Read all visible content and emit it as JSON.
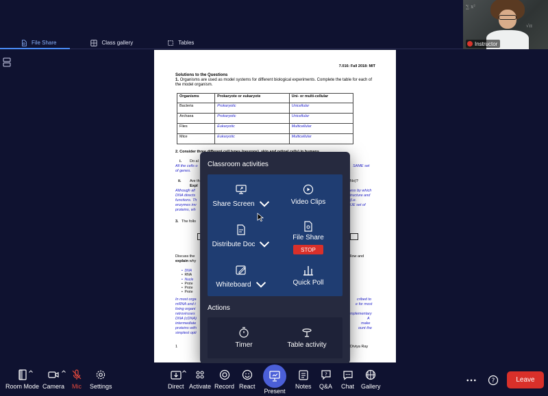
{
  "instructor": {
    "label": "Instructor"
  },
  "tabs": [
    {
      "label": "File Share",
      "icon": "file-share-icon",
      "active": true
    },
    {
      "label": "Class gallery",
      "icon": "gallery-icon",
      "active": false
    },
    {
      "label": "Tables",
      "icon": "tables-icon",
      "active": false
    }
  ],
  "document": {
    "header": "7.016: Fall 2018: MIT",
    "solutions_title": "Solutions to the Questions",
    "q1_number": "1.",
    "q1_text": "Organisms are used as model systems for different biological experiments. Complete the table for each of the model organism.",
    "table": {
      "headers": [
        "Organisms",
        "Prokaryote or eukaryote",
        "Uni- or multi-cellular"
      ],
      "rows": [
        [
          "Bacteria",
          "Prokaryotic",
          "Unicellular"
        ],
        [
          "Archaea",
          "Prokaryotic",
          "Unicellular"
        ],
        [
          "Flies",
          "Eukaryotic",
          "Multicellular"
        ],
        [
          "Mice",
          "Eukaryotic",
          "Multicellular"
        ]
      ]
    },
    "q2": "2. Consider three different cell types (neurons), skin and retinal cells) in humans.",
    "q2_i": "i.",
    "q2_i_text": "Do al",
    "q2_i_ans": "All the cells o",
    "q2_i_ans_r": "SAME set",
    "q2_i_ans2": "of genes.",
    "q2_ii": "ii.",
    "q2_ii_text": "Are th",
    "q2_ii_r": "No)?",
    "q2_ii_expl": "Expl",
    "ans_a1": "Although all",
    "ans_a1_r": "ess by which",
    "ans_a2": "DNA directs",
    "ans_a2_r": "tructure and",
    "ans_a3": "functions. Th",
    "ans_a3_r": "(i.e.",
    "ans_a4": "enzymes inv",
    "ans_a4_r": "UE set of",
    "ans_a5": "proteins, wh",
    "q3": "3.",
    "q3_text": "The follo",
    "discuss": "Discuss the",
    "discuss_r": "llow and",
    "explain": "explain",
    "explain_rest": "why",
    "bullets": [
      "DNA",
      "RNA",
      "Nucle",
      "Prote",
      "Prote",
      "Prote"
    ],
    "ans_b1": "In most orga",
    "ans_b1_r": "cribed to",
    "ans_b2": "mRNA and t",
    "ans_b2_r": "e for most",
    "ans_b3": "living organi",
    "ans_b4": "retroviruses",
    "ans_b4_r": "mplementary",
    "ans_b5": "DNA (cDNA)",
    "ans_b5_r": "A",
    "ans_b6": "intermediate",
    "ans_b6_r": "make",
    "ans_b7": "proteins with",
    "ans_b7_r": "ount the",
    "ans_b8": "simplest opti",
    "footer_left": "1",
    "footer_right": "Diviya Ray"
  },
  "popup": {
    "title": "Classroom activities",
    "activities": [
      {
        "label": "Share Screen",
        "icon": "share-screen-icon",
        "has_menu": true
      },
      {
        "label": "Video Clips",
        "icon": "video-clips-icon",
        "has_menu": false
      },
      {
        "label": "Distribute Doc",
        "icon": "distribute-doc-icon",
        "has_menu": true
      },
      {
        "label": "File Share",
        "icon": "file-share-icon",
        "has_menu": false,
        "stop_label": "STOP"
      },
      {
        "label": "Whiteboard",
        "icon": "whiteboard-icon",
        "has_menu": true
      },
      {
        "label": "Quick Poll",
        "icon": "quick-poll-icon",
        "has_menu": false
      }
    ],
    "actions_title": "Actions",
    "actions": [
      {
        "label": "Timer",
        "icon": "timer-icon"
      },
      {
        "label": "Table activity",
        "icon": "table-activity-icon"
      }
    ]
  },
  "toolbar": {
    "room_mode": "Room Mode",
    "camera": "Camera",
    "mic": "Mic",
    "settings": "Settings",
    "direct": "Direct",
    "activate": "Activate",
    "record": "Record",
    "react": "React",
    "present": "Present",
    "notes": "Notes",
    "qa": "Q&A",
    "chat": "Chat",
    "gallery": "Gallery",
    "leave": "Leave"
  },
  "colors": {
    "background": "#0f1230",
    "accent": "#4a8cf7",
    "stop_red": "#d9302a",
    "mic_red": "#e64a3d",
    "present_blue": "#4b5fd8",
    "activity_panel": "#1f3d72"
  }
}
